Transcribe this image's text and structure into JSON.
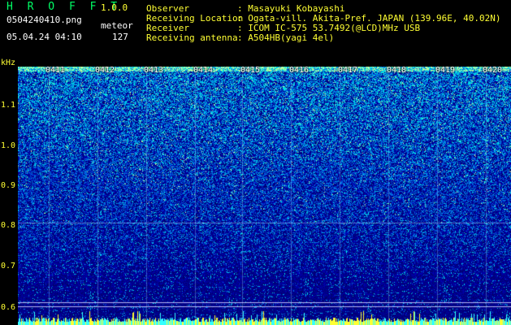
{
  "app": {
    "title": "H R O F F T",
    "version": "1.0.0",
    "filename": "0504240410.png",
    "meteor_label": "meteor",
    "datetime": "05.04.24 04:10",
    "meteor_count": "127"
  },
  "info": [
    {
      "label": "Observer",
      "value": ": Masayuki Kobayashi"
    },
    {
      "label": "Receiving Location",
      "value": ": Ogata-vill. Akita-Pref. JAPAN (139.96E, 40.02N)"
    },
    {
      "label": "Receiver",
      "value": ": ICOM IC-575 53.7492(@LCD)MHz USB"
    },
    {
      "label": "Receiving antenna",
      "value": ": A504HB(yagi 4el)"
    }
  ],
  "axis": {
    "unit": "kHz",
    "freq_ticks": [
      "1.1",
      "1.0",
      "0.9",
      "0.8",
      "0.7",
      "0.6"
    ],
    "time_ticks": [
      "0411",
      "0412",
      "0413",
      "0414",
      "0415",
      "0416",
      "0417",
      "0418",
      "0419",
      "0420"
    ]
  },
  "colors": {
    "text_green": "#00ff66",
    "text_yellow": "#ffff33",
    "spectrum_low": "#000080",
    "spectrum_high": "#00ffff"
  }
}
